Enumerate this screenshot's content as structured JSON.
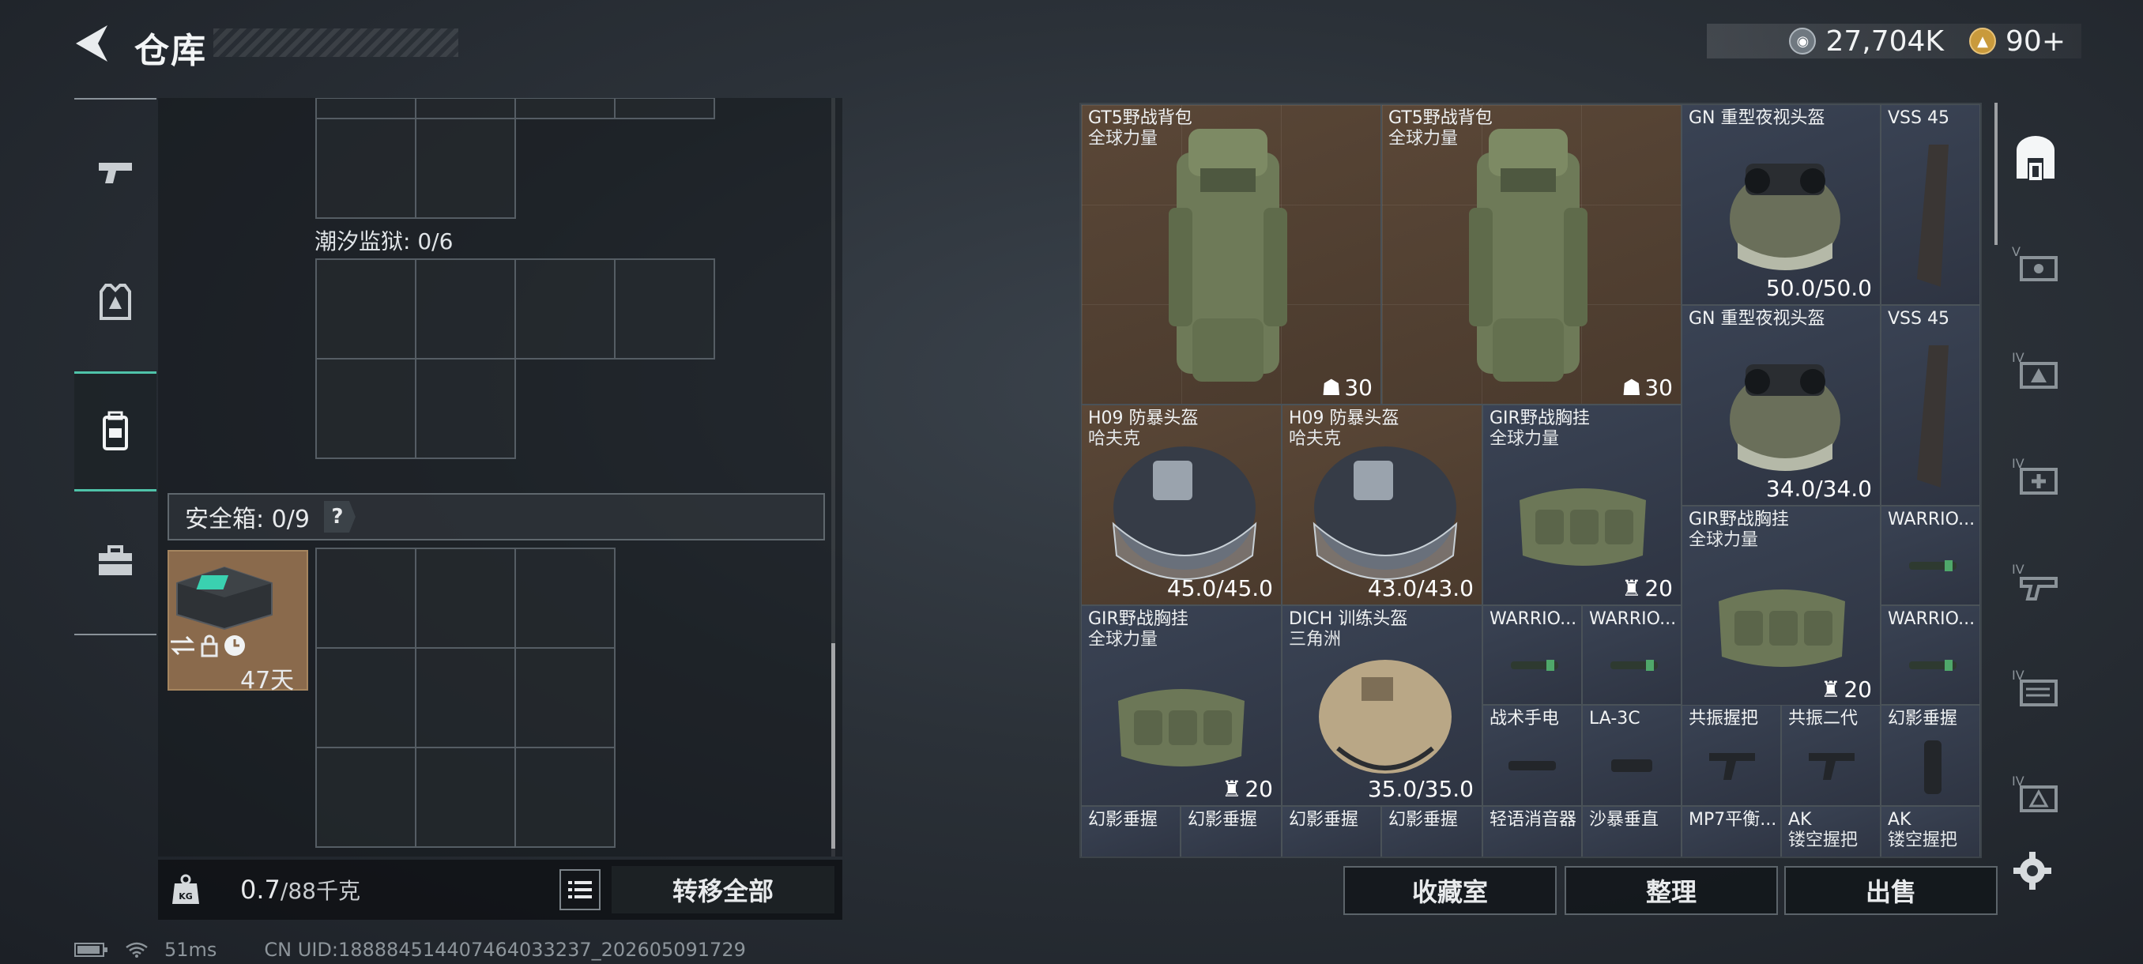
{
  "header": {
    "title": "仓库",
    "currency_1": "27,704K",
    "currency_2": "90+"
  },
  "left_nav": {
    "items": [
      "weapon-icon",
      "armor-icon",
      "backpack-icon",
      "toolbox-icon"
    ],
    "active_index": 2
  },
  "storage": {
    "section_label": "潮汐监狱: 0/6",
    "safebox_label": "安全箱: 0/9",
    "help_label": "?",
    "safebox_item_time": "47天",
    "weight_value": "0.7",
    "weight_capacity": "/88千克",
    "transfer_all": "转移全部"
  },
  "inventory": {
    "items": [
      {
        "name": "GT5野战背包",
        "sub": "全球力量",
        "count": "30"
      },
      {
        "name": "GT5野战背包",
        "sub": "全球力量",
        "count": "30"
      },
      {
        "name": "GN 重型夜视头盔",
        "durability": "50.0/50.0"
      },
      {
        "name": "VSS 45"
      },
      {
        "name": "GN 重型夜视头盔",
        "durability": "34.0/34.0"
      },
      {
        "name": "VSS 45"
      },
      {
        "name": "H09 防暴头盔",
        "sub": "哈夫克",
        "durability": "45.0/45.0"
      },
      {
        "name": "H09 防暴头盔",
        "sub": "哈夫克",
        "durability": "43.0/43.0"
      },
      {
        "name": "GIR野战胸挂",
        "sub": "全球力量",
        "count": "20"
      },
      {
        "name": "GIR野战胸挂",
        "sub": "全球力量",
        "count": "20"
      },
      {
        "name": "WARRIO..."
      },
      {
        "name": "GIR野战胸挂",
        "sub": "全球力量",
        "count": "20"
      },
      {
        "name": "DICH 训练头盔",
        "sub": "三角洲",
        "durability": "35.0/35.0"
      },
      {
        "name": "WARRIO..."
      },
      {
        "name": "WARRIO..."
      },
      {
        "name": "WARRIO..."
      },
      {
        "name": "战术手电"
      },
      {
        "name": "LA-3C"
      },
      {
        "name": "共振握把"
      },
      {
        "name": "共振二代"
      },
      {
        "name": "幻影垂握"
      },
      {
        "name": "幻影垂握"
      },
      {
        "name": "幻影垂握"
      },
      {
        "name": "幻影垂握"
      },
      {
        "name": "幻影垂握"
      },
      {
        "name": "轻语消音器"
      },
      {
        "name": "沙暴垂直"
      },
      {
        "name": "MP7平衡..."
      },
      {
        "name": "AK",
        "sub": "镂空握把"
      },
      {
        "name": "AK",
        "sub": "镂空握把"
      }
    ]
  },
  "buttons": {
    "collection": "收藏室",
    "sort": "整理",
    "sell": "出售"
  },
  "status": {
    "ping": "51ms",
    "uid": "CN UID:188884514407464033237_202605091729"
  },
  "colors": {
    "accent": "#4fc3a9",
    "item_brown": "#4a3a2d",
    "item_blue": "#2e3442"
  }
}
